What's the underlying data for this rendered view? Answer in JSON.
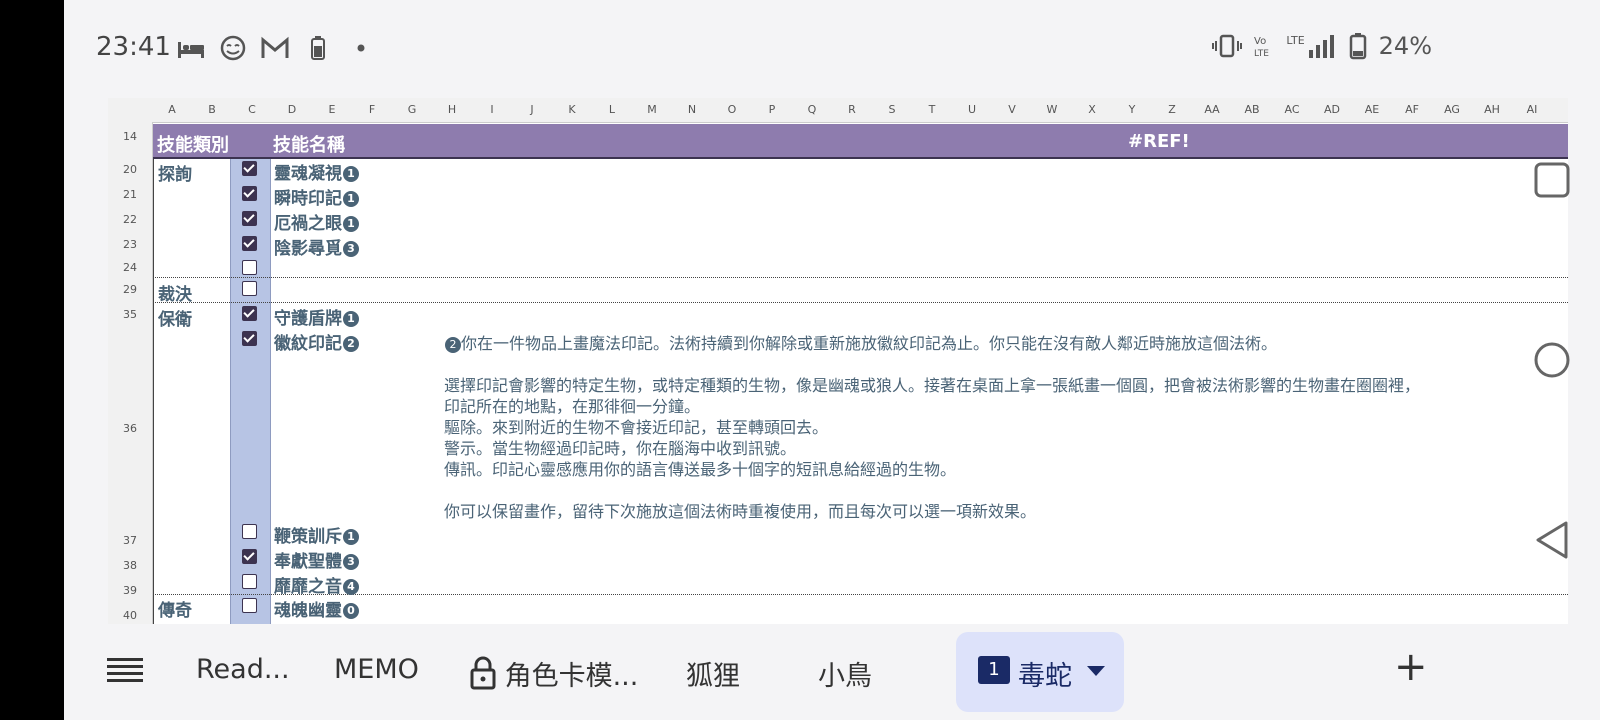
{
  "status_bar": {
    "time": "23:41",
    "battery": "24%",
    "network": "LTE",
    "icons": [
      "bed-icon",
      "face-icon",
      "gmail-icon",
      "battery-small-icon",
      "dot-icon",
      "vibrate-icon",
      "volte-icon",
      "signal-icon",
      "battery-icon"
    ]
  },
  "columns": [
    "A",
    "B",
    "C",
    "D",
    "E",
    "F",
    "G",
    "H",
    "I",
    "J",
    "K",
    "L",
    "M",
    "N",
    "O",
    "P",
    "Q",
    "R",
    "S",
    "T",
    "U",
    "V",
    "W",
    "X",
    "Y",
    "Z",
    "AA",
    "AB",
    "AC",
    "AD",
    "AE",
    "AF",
    "AG",
    "AH",
    "AI"
  ],
  "rows": [
    "14",
    "20",
    "21",
    "22",
    "23",
    "24",
    "29",
    "35",
    "36",
    "37",
    "38",
    "39",
    "40"
  ],
  "header": {
    "category": "技能類別",
    "skill": "技能名稱",
    "ref": "#REF!"
  },
  "categories": {
    "investigate": "探詢",
    "judge": "裁決",
    "guard": "保衛",
    "legend": "傳奇"
  },
  "skills": {
    "s20": "靈魂凝視",
    "s20n": "1",
    "s21": "瞬時印記",
    "s21n": "1",
    "s22": "厄禍之眼",
    "s22n": "1",
    "s23": "陰影尋覓",
    "s23n": "3",
    "s35": "守護盾牌",
    "s35n": "1",
    "s36": "徽紋印記",
    "s36n": "2",
    "s37": "鞭策訓斥",
    "s37n": "1",
    "s38": "奉獻聖體",
    "s38n": "3",
    "s39": "靡靡之音",
    "s39n": "4",
    "s40": "魂魄幽靈",
    "s40n": "0"
  },
  "checkboxes": {
    "r20": true,
    "r21": true,
    "r22": true,
    "r23": true,
    "r24": false,
    "r29": false,
    "r35": true,
    "r36": true,
    "r37": false,
    "r38": true,
    "r39": false,
    "r40": false
  },
  "description": {
    "badge": "2",
    "line1": "你在一件物品上畫魔法印記。法術持續到你解除或重新施放徽紋印記為止。你只能在沒有敵人鄰近時施放這個法術。",
    "line2": "選擇印記會影響的特定生物，或特定種類的生物，像是幽魂或狼人。接著在桌面上拿一張紙畫一個圓，把會被法術影響的生物畫在圈圈裡，",
    "line3": "印記所在的地點，在那徘徊一分鐘。",
    "line4": "驅除。來到附近的生物不會接近印記，甚至轉頭回去。",
    "line5": "警示。當生物經過印記時，你在腦海中收到訊號。",
    "line6": "傳訊。印記心靈感應用你的語言傳送最多十個字的短訊息給經過的生物。",
    "line7": "你可以保留畫作，留待下次施放這個法術時重複使用，而且每次可以選一項新效果。"
  },
  "tabs": {
    "menu_icon": "menu-icon",
    "t1": "Read...",
    "t2": "MEMO",
    "t3": "角色卡模...",
    "t4": "狐狸",
    "t5": "小鳥",
    "t6_badge": "1",
    "t6": "毒蛇",
    "add": "+"
  },
  "colors": {
    "header_bg": "#8e7cae",
    "checkbox_col": "#b7c4e4",
    "text": "#4a6376",
    "active_tab": "#dde2fa"
  }
}
